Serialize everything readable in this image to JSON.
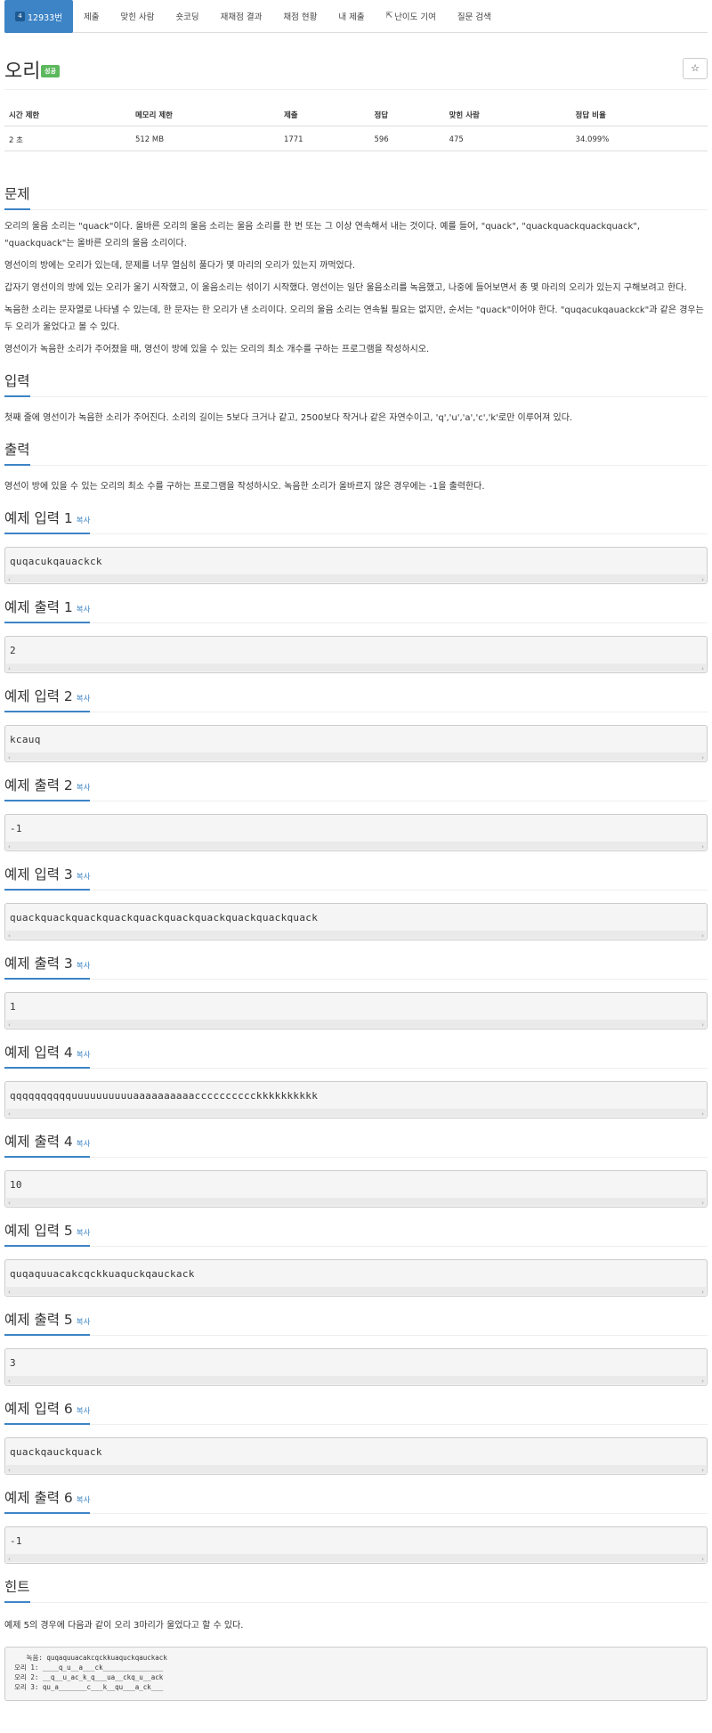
{
  "nav": {
    "items": [
      {
        "label": "12933번",
        "active": true
      },
      {
        "label": "제출"
      },
      {
        "label": "맞힌 사람"
      },
      {
        "label": "숏코딩"
      },
      {
        "label": "재채점 결과"
      },
      {
        "label": "채점 현황"
      },
      {
        "label": "내 제출"
      },
      {
        "label": "난이도 기여",
        "icon": "external-link-icon"
      },
      {
        "label": "질문 검색"
      }
    ],
    "badge_icon": "4"
  },
  "problem": {
    "title": "오리",
    "status_badge": "성공",
    "star": "☆"
  },
  "info": {
    "headers": [
      "시간 제한",
      "메모리 제한",
      "제출",
      "정답",
      "맞힌 사람",
      "정답 비율"
    ],
    "values": [
      "2 초",
      "512 MB",
      "1771",
      "596",
      "475",
      "34.099%"
    ]
  },
  "sections": {
    "problem_head": "문제",
    "problem_p1": "오리의 울음 소리는 \"quack\"이다. 올바른 오리의 울음 소리는 울음 소리를 한 번 또는 그 이상 연속해서 내는 것이다. 예를 들어, \"quack\", \"quackquackquackquack\", \"quackquack\"는 올바른 오리의 울음 소리이다.",
    "problem_p2": "영선이의 방에는 오리가 있는데, 문제를 너무 열심히 풀다가 몇 마리의 오리가 있는지 까먹었다.",
    "problem_p3": "갑자기 영선이의 방에 있는 오리가 울기 시작했고, 이 울음소리는 섞이기 시작했다. 영선이는 일단 울음소리를 녹음했고, 나중에 들어보면서 총 몇 마리의 오리가 있는지 구해보려고 한다.",
    "problem_p4": "녹음한 소리는 문자열로 나타낼 수 있는데, 한 문자는 한 오리가 낸 소리이다. 오리의 울음 소리는 연속될 필요는 없지만, 순서는 \"quack\"이어야 한다. \"quqacukqauackck\"과 같은 경우는 두 오리가 울었다고 볼 수 있다.",
    "problem_p5": "영선이가 녹음한 소리가 주어졌을 때, 영선이 방에 있을 수 있는 오리의 최소 개수를 구하는 프로그램을 작성하시오.",
    "input_head": "입력",
    "input_p": "첫째 줄에 영선이가 녹음한 소리가 주어진다. 소리의 길이는 5보다 크거나 같고, 2500보다 작거나 같은 자연수이고, 'q','u','a','c','k'로만 이루어져 있다.",
    "output_head": "출력",
    "output_p": "영선이 방에 있을 수 있는 오리의 최소 수를 구하는 프로그램을 작성하시오. 녹음한 소리가 올바르지 않은 경우에는 -1을 출력한다.",
    "copy_label": "복사",
    "hint_head": "힌트",
    "hint_p": "예제 5의 경우에 다음과 같이 오리 3마리가 울었다고 할 수 있다."
  },
  "examples": [
    {
      "head": "예제 입력 1",
      "code": "quqacukqauackck"
    },
    {
      "head": "예제 출력 1",
      "code": "2"
    },
    {
      "head": "예제 입력 2",
      "code": "kcauq"
    },
    {
      "head": "예제 출력 2",
      "code": "-1"
    },
    {
      "head": "예제 입력 3",
      "code": "quackquackquackquackquackquackquackquackquackquack"
    },
    {
      "head": "예제 출력 3",
      "code": "1"
    },
    {
      "head": "예제 입력 4",
      "code": "qqqqqqqqqquuuuuuuuuuaaaaaaaaaacccccccccckkkkkkkkkk"
    },
    {
      "head": "예제 출력 4",
      "code": "10"
    },
    {
      "head": "예제 입력 5",
      "code": "quqaquuacakcqckkuaquckqauckack"
    },
    {
      "head": "예제 출력 5",
      "code": "3"
    },
    {
      "head": "예제 입력 6",
      "code": "quackqauckquack"
    },
    {
      "head": "예제 출력 6",
      "code": "-1"
    }
  ],
  "hint_lines": [
    "   녹음: quqaquuacakcqckkuaquckqauckack",
    "오리 1: ____q_u__a___ck_______________",
    "오리 2: __q__u_ac_k_q___ua__ckq_u__ack",
    "오리 3: qu_a_______c___k__qu___a_ck___"
  ]
}
